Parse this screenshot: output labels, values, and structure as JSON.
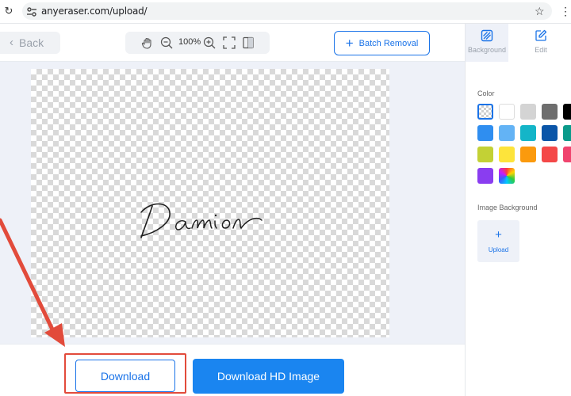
{
  "browser": {
    "url": "anyeraser.com/upload/",
    "reload_glyph": "↻",
    "star_glyph": "☆",
    "menu_glyph": "⋮"
  },
  "toolbar": {
    "back_label": "Back",
    "back_glyph": "‹",
    "zoom_level": "100%",
    "batch_label": "Batch Removal",
    "batch_glyph": "+"
  },
  "canvas": {
    "background": "transparent-checkerboard",
    "signature_text": "Damion"
  },
  "bottom": {
    "download_label": "Download",
    "download_hd_label": "Download HD Image"
  },
  "panel": {
    "tabs": [
      {
        "label": "Background",
        "icon": "background-icon",
        "active": true
      },
      {
        "label": "Edit",
        "icon": "edit-icon",
        "active": false
      }
    ],
    "color_label": "Color",
    "colors": [
      "transparent",
      "#ffffff",
      "#d4d4d4",
      "#6e6e6e",
      "#000000",
      "#2f8ef0",
      "#63b3f5",
      "#14b5c8",
      "#0a55a8",
      "#0b9a8a",
      "#c3d135",
      "#fde43b",
      "#fb9a0d",
      "#f44848",
      "#f0446e",
      "#8a3df0",
      "rainbow"
    ],
    "image_background_label": "Image Background",
    "upload_glyph": "+",
    "upload_label": "Upload"
  },
  "colors": {
    "accent": "#1a73e8",
    "primary_button": "#1a85f0",
    "highlight": "#e24b3b",
    "workspace_bg": "#eef1f8"
  }
}
